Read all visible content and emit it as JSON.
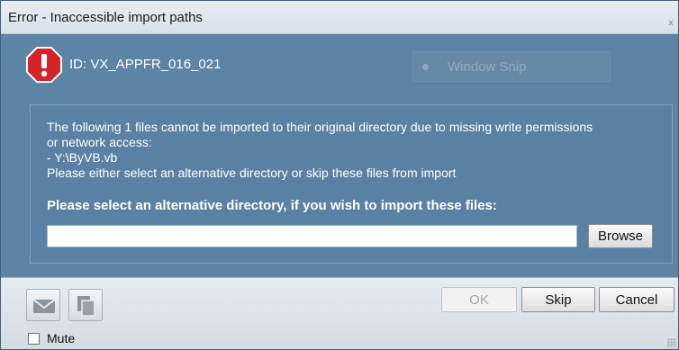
{
  "window": {
    "title": "Error - Inaccessible import paths",
    "close_glyph": "x"
  },
  "header": {
    "error_id": "ID: VX_APPFR_016_021",
    "icon": "error-octagon-icon",
    "snip_label": "Window Snip"
  },
  "message": {
    "line1": "The following 1 files cannot be imported to their original directory due to missing write permissions",
    "line2": "or network access:",
    "file": "- Y:\\ByVB.vb",
    "hint": "Please either select an alternative directory or skip these files from import",
    "prompt": "Please select an alternative directory, if you wish to import these files:"
  },
  "path_input": {
    "value": "",
    "placeholder": ""
  },
  "buttons": {
    "browse": "Browse",
    "ok": "OK",
    "skip": "Skip",
    "cancel": "Cancel"
  },
  "footer": {
    "mail_icon": "mail-icon",
    "copy_icon": "copy-icon",
    "mute_label": "Mute",
    "mute_checked": false
  },
  "colors": {
    "dialog_bg": "#5d83a5",
    "error_red": "#d4232b"
  }
}
